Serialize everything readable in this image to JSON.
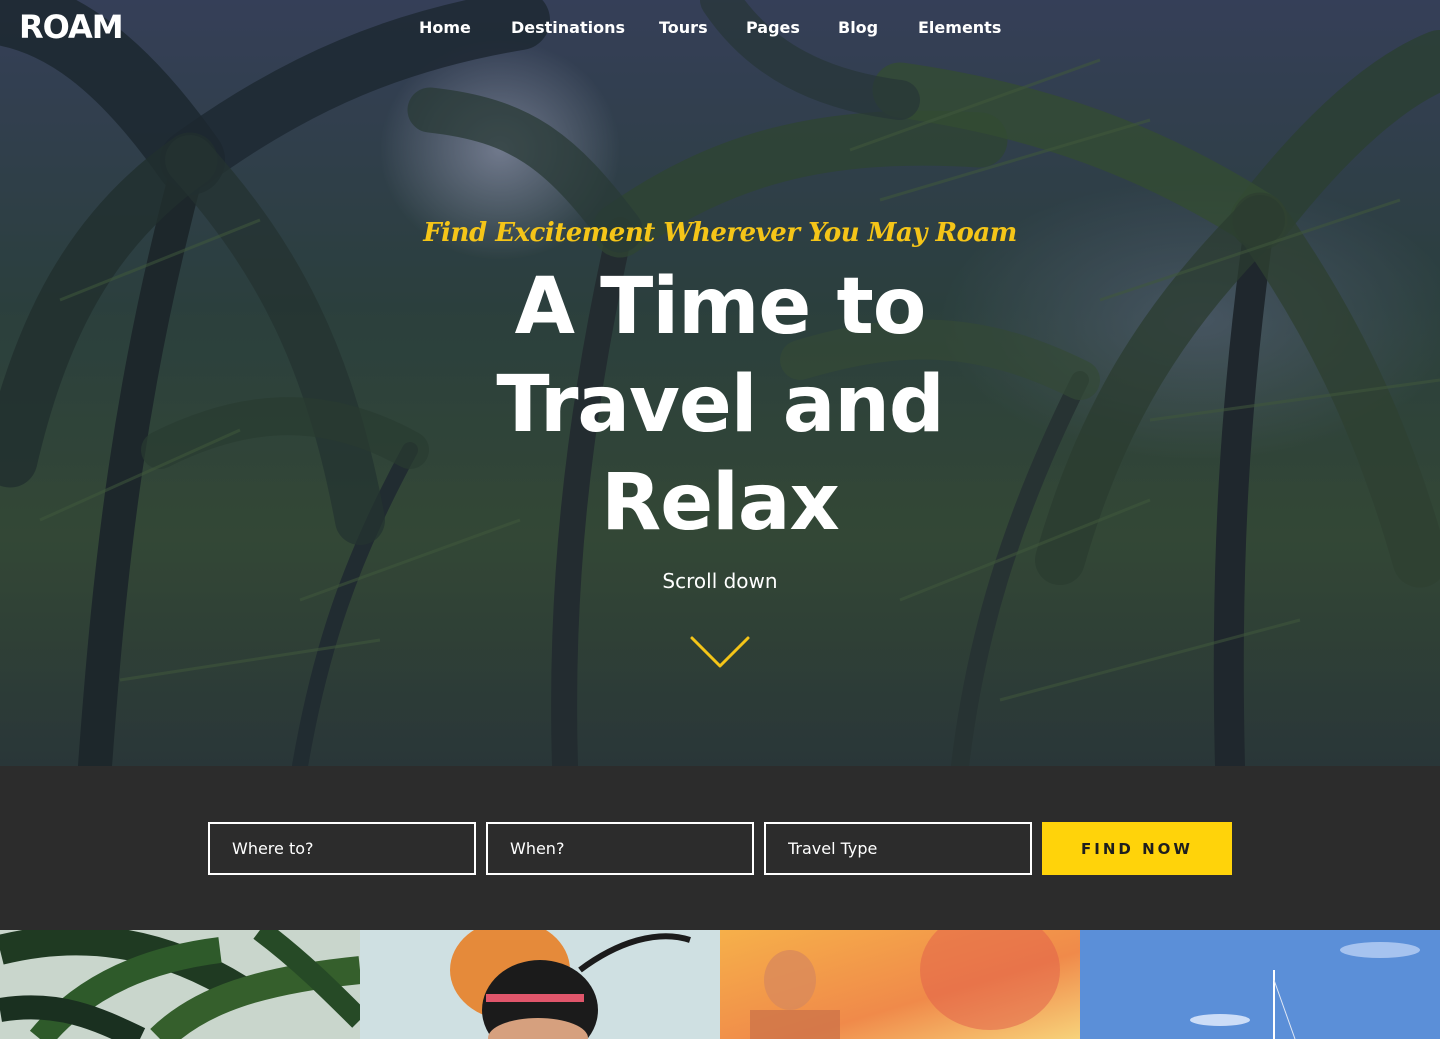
{
  "header": {
    "logo": "ROAM",
    "nav": [
      {
        "label": "Home"
      },
      {
        "label": "Destinations"
      },
      {
        "label": "Tours"
      },
      {
        "label": "Pages"
      },
      {
        "label": "Blog"
      },
      {
        "label": "Elements"
      }
    ]
  },
  "hero": {
    "tagline": "Find Excitement Wherever You May Roam",
    "headline": "A Time to Travel and Relax",
    "scroll_label": "Scroll down",
    "scroll_icon": "chevron-down-icon",
    "background_image": "palm-trees-photo"
  },
  "search": {
    "where_placeholder": "Where to?",
    "when_placeholder": "When?",
    "type_placeholder": "Travel Type",
    "button_label": "FIND NOW"
  },
  "thumbnails": [
    {
      "image": "palm-leaves-photo"
    },
    {
      "image": "traveler-portrait-photo"
    },
    {
      "image": "sunset-silhouette-photo"
    },
    {
      "image": "sailboat-sky-photo"
    }
  ],
  "colors": {
    "accent": "#ffd30a",
    "tagline": "#f5c518",
    "search_band": "#2c2c2c",
    "text": "#ffffff"
  }
}
